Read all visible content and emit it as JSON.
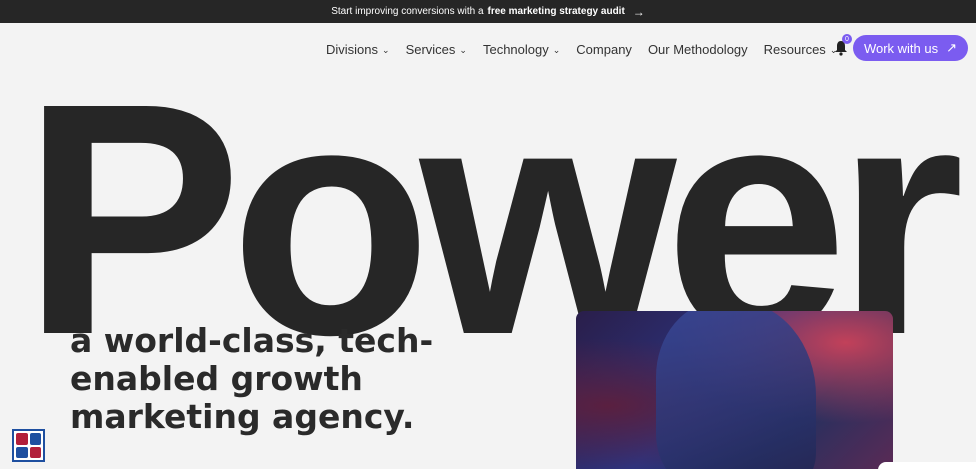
{
  "announcement": {
    "prefix": "Start improving conversions with a",
    "emphasis": "free marketing strategy audit",
    "arrow": "→"
  },
  "nav": {
    "items": [
      {
        "label": "Divisions",
        "has_dropdown": true
      },
      {
        "label": "Services",
        "has_dropdown": true
      },
      {
        "label": "Technology",
        "has_dropdown": true
      },
      {
        "label": "Company",
        "has_dropdown": false
      },
      {
        "label": "Our Methodology",
        "has_dropdown": false
      },
      {
        "label": "Resources",
        "has_dropdown": true
      }
    ],
    "chevron": "⌄",
    "notifications_count": "0",
    "cta_label": "Work with us",
    "cta_arrow": "↗"
  },
  "hero": {
    "word": "Power",
    "subhead": "a world-class, tech-enabled growth marketing agency."
  },
  "colors": {
    "accent": "#7b5cf0",
    "dark": "#262626",
    "background": "#f3f3f3"
  },
  "icons": {
    "bell": "bell-icon",
    "a11y": "accessibility-widget-icon"
  }
}
